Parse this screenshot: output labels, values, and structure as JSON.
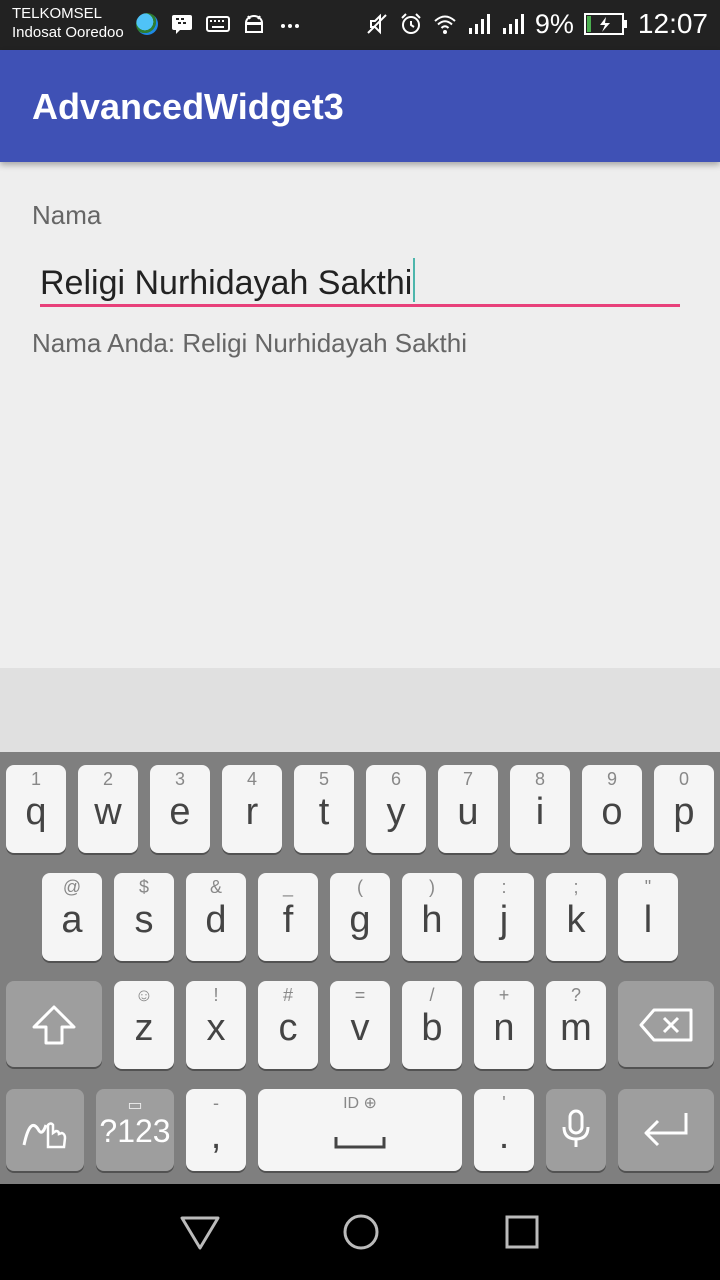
{
  "status_bar": {
    "carrier_1": "TELKOMSEL",
    "carrier_2": "Indosat Ooredoo",
    "battery": "9%",
    "time": "12:07"
  },
  "app_bar": {
    "title": "AdvancedWidget3"
  },
  "form": {
    "label": "Nama",
    "input_value": "Religi Nurhidayah Sakthi",
    "output_text": "Nama Anda: Religi Nurhidayah Sakthi"
  },
  "keyboard": {
    "row1": [
      {
        "hint": "1",
        "key": "q"
      },
      {
        "hint": "2",
        "key": "w"
      },
      {
        "hint": "3",
        "key": "e"
      },
      {
        "hint": "4",
        "key": "r"
      },
      {
        "hint": "5",
        "key": "t"
      },
      {
        "hint": "6",
        "key": "y"
      },
      {
        "hint": "7",
        "key": "u"
      },
      {
        "hint": "8",
        "key": "i"
      },
      {
        "hint": "9",
        "key": "o"
      },
      {
        "hint": "0",
        "key": "p"
      }
    ],
    "row2": [
      {
        "hint": "@",
        "key": "a"
      },
      {
        "hint": "$",
        "key": "s"
      },
      {
        "hint": "&",
        "key": "d"
      },
      {
        "hint": "_",
        "key": "f"
      },
      {
        "hint": "(",
        "key": "g"
      },
      {
        "hint": ")",
        "key": "h"
      },
      {
        "hint": ":",
        "key": "j"
      },
      {
        "hint": ";",
        "key": "k"
      },
      {
        "hint": "\"",
        "key": "l"
      }
    ],
    "row3": [
      {
        "hint": "☺",
        "key": "z"
      },
      {
        "hint": "!",
        "key": "x"
      },
      {
        "hint": "#",
        "key": "c"
      },
      {
        "hint": "=",
        "key": "v"
      },
      {
        "hint": "/",
        "key": "b"
      },
      {
        "hint": "+",
        "key": "n"
      },
      {
        "hint": "?",
        "key": "m"
      }
    ],
    "symbols_label": "?123",
    "comma_hint": "-",
    "comma": ",",
    "space_hint": "ID",
    "period_hint": "'",
    "period": "."
  },
  "colors": {
    "app_bar": "#3f51b5",
    "accent": "#e8407a"
  }
}
